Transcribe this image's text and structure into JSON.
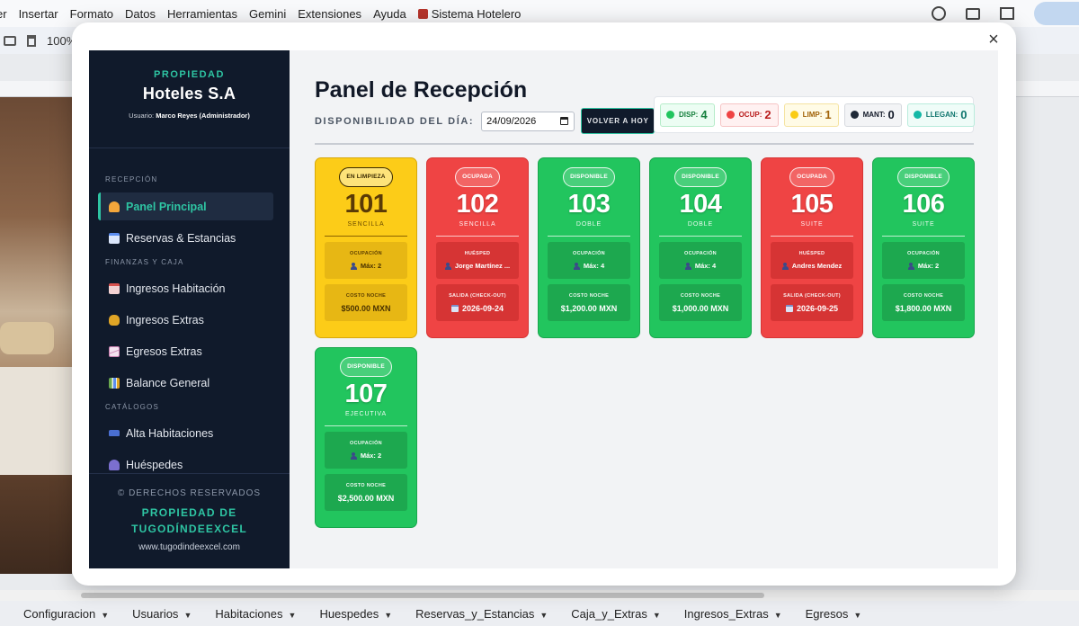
{
  "menubar": {
    "items": [
      "er",
      "Insertar",
      "Formato",
      "Datos",
      "Herramientas",
      "Gemini",
      "Extensiones",
      "Ayuda",
      "Sistema Hotelero"
    ]
  },
  "toolbar": {
    "zoom": "100%"
  },
  "sheet_tabs": [
    "Configuracion",
    "Usuarios",
    "Habitaciones",
    "Huespedes",
    "Reservas_y_Estancias",
    "Caja_y_Extras",
    "Ingresos_Extras",
    "Egresos"
  ],
  "modal": {
    "close_label": "×"
  },
  "sidebar": {
    "kicker": "PROPIEDAD",
    "title": "Hoteles S.A",
    "user_label": "Usuario:",
    "user_name": "Marco Reyes (Administrador)",
    "sections": {
      "recepcion": "RECEPCIÓN",
      "finanzas": "FINANZAS Y CAJA",
      "catalogos": "CATÁLOGOS"
    },
    "items": [
      {
        "label": "Panel Principal",
        "icon": "bell-icon",
        "color": "#f4a73b"
      },
      {
        "label": "Reservas & Estancias",
        "icon": "calendar-icon",
        "color": "#5b8def"
      },
      {
        "label": "Ingresos Habitación",
        "icon": "hotel-icon",
        "color": "#d9534f"
      },
      {
        "label": "Ingresos Extras",
        "icon": "money-bag-icon",
        "color": "#e0a526"
      },
      {
        "label": "Egresos Extras",
        "icon": "chart-down-icon",
        "color": "#c97fb0"
      },
      {
        "label": "Balance General",
        "icon": "bar-chart-icon",
        "color": "#6aa84f"
      },
      {
        "label": "Alta Habitaciones",
        "icon": "bed-icon",
        "color": "#4a6fd1"
      },
      {
        "label": "Huéspedes",
        "icon": "people-icon",
        "color": "#7b6fcf"
      }
    ],
    "footer": {
      "rights": "© DERECHOS RESERVADOS",
      "owner_line1": "PROPIEDAD DE",
      "owner_line2": "TUGODÍNDEEXCEL",
      "web": "www.tugodindeexcel.com"
    }
  },
  "main": {
    "title": "Panel de Recepción",
    "date_label": "DISPONIBILIDAD DEL DÍA:",
    "date_value": "24/09/2026",
    "today_button": "VOLVER A HOY",
    "stats": [
      {
        "label": "DISP:",
        "value": "4",
        "color": "#22c55e"
      },
      {
        "label": "OCUP:",
        "value": "2",
        "color": "#ef4444"
      },
      {
        "label": "LIMP:",
        "value": "1",
        "color": "#facc15"
      },
      {
        "label": "MANT:",
        "value": "0",
        "color": "#1f2937"
      },
      {
        "label": "LLEGAN:",
        "value": "0",
        "color": "#14b8a6"
      }
    ]
  },
  "rooms": [
    {
      "number": "101",
      "status": "EN LIMPIEZA",
      "type": "SENCILLA",
      "color": "yellow",
      "info1_title": "OCUPACIÓN",
      "info1_value": "Máx: 2",
      "info2_title": "COSTO NOCHE",
      "info2_value": "$500.00 MXN"
    },
    {
      "number": "102",
      "status": "OCUPADA",
      "type": "SENCILLA",
      "color": "red",
      "info1_title": "HUÉSPED",
      "info1_value": "Jorge Martínez ...",
      "info2_title": "SALIDA (CHECK-OUT)",
      "info2_value": "2026-09-24"
    },
    {
      "number": "103",
      "status": "DISPONIBLE",
      "type": "DOBLE",
      "color": "green",
      "info1_title": "OCUPACIÓN",
      "info1_value": "Máx: 4",
      "info2_title": "COSTO NOCHE",
      "info2_value": "$1,200.00 MXN"
    },
    {
      "number": "104",
      "status": "DISPONIBLE",
      "type": "DOBLE",
      "color": "green",
      "info1_title": "OCUPACIÓN",
      "info1_value": "Máx: 4",
      "info2_title": "COSTO NOCHE",
      "info2_value": "$1,000.00 MXN"
    },
    {
      "number": "105",
      "status": "OCUPADA",
      "type": "SUITE",
      "color": "red",
      "info1_title": "HUÉSPED",
      "info1_value": "Andres Mendez",
      "info2_title": "SALIDA (CHECK-OUT)",
      "info2_value": "2026-09-25"
    },
    {
      "number": "106",
      "status": "DISPONIBLE",
      "type": "SUITE",
      "color": "green",
      "info1_title": "OCUPACIÓN",
      "info1_value": "Máx: 2",
      "info2_title": "COSTO NOCHE",
      "info2_value": "$1,800.00 MXN"
    },
    {
      "number": "107",
      "status": "DISPONIBLE",
      "type": "EJECUTIVA",
      "color": "green",
      "info1_title": "OCUPACIÓN",
      "info1_value": "Máx: 2",
      "info2_title": "COSTO NOCHE",
      "info2_value": "$2,500.00 MXN"
    }
  ]
}
